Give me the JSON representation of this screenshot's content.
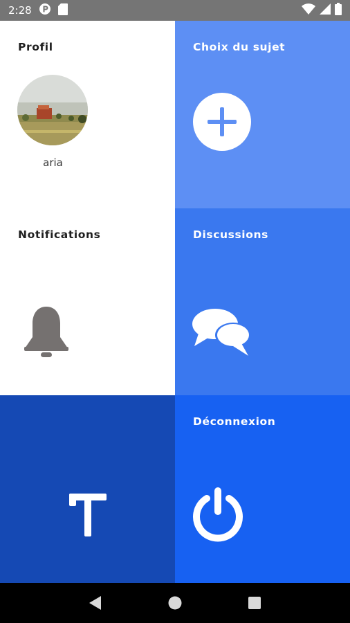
{
  "status_bar": {
    "time": "2:28",
    "icons": [
      "app-badge-icon",
      "sd-card-icon",
      "wifi-icon",
      "signal-icon",
      "battery-icon"
    ]
  },
  "tiles": {
    "profil": {
      "title": "Profil",
      "user_name": "aria"
    },
    "choix_du_sujet": {
      "title": "Choix du sujet",
      "icon": "plus-circle-icon"
    },
    "notifications": {
      "title": "Notifications",
      "icon": "bell-icon"
    },
    "discussions": {
      "title": "Discussions",
      "icon": "chat-bubbles-icon"
    },
    "logo": {
      "icon": "app-logo-icon"
    },
    "deconnexion": {
      "title": "Déconnexion",
      "icon": "power-icon"
    }
  },
  "colors": {
    "status_bar": "#757575",
    "choix_bg": "#5d8ff4",
    "discussions_bg": "#3a78ef",
    "logo_bg": "#1549b4",
    "deconnexion_bg": "#1761f2",
    "bell": "#757170"
  },
  "nav_bar": {
    "buttons": [
      "back-icon",
      "home-icon",
      "recents-icon"
    ]
  }
}
